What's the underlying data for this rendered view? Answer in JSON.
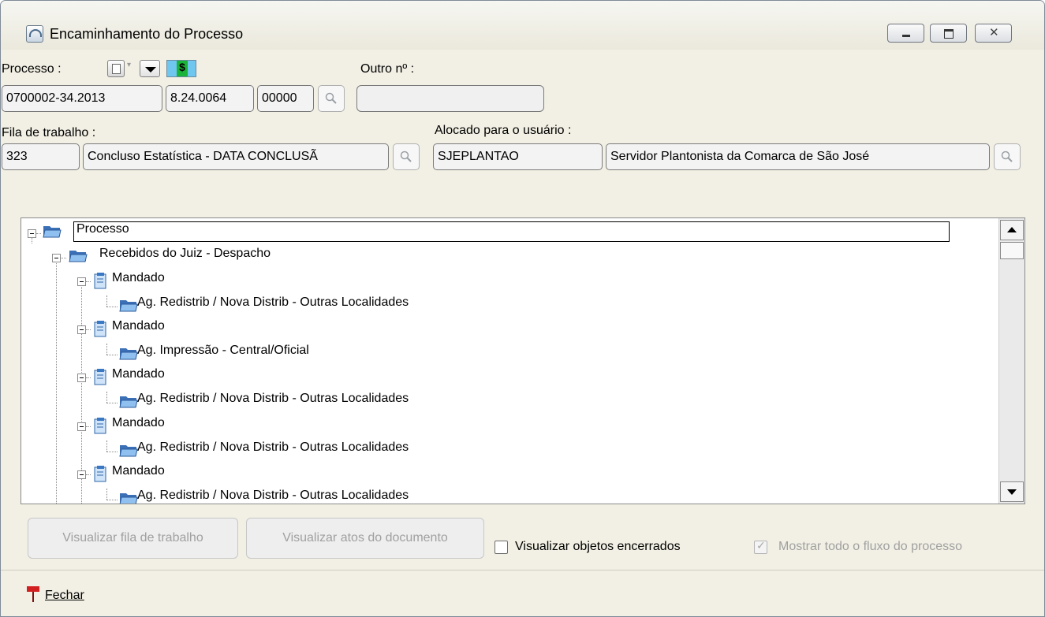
{
  "window": {
    "title": "Encaminhamento do Processo"
  },
  "processo": {
    "label": "Processo :",
    "parts": [
      "0700002-34.2013",
      "8.24.0064",
      "00000"
    ]
  },
  "outro_numero": {
    "label": "Outro nº :",
    "value": ""
  },
  "fila": {
    "label": "Fila de trabalho :",
    "code": "323",
    "name": "Concluso Estatística  - DATA CONCLUSÃ"
  },
  "alocado": {
    "label": "Alocado para o usuário :",
    "login": "SJEPLANTAO",
    "name": "Servidor Plantonista da Comarca de São José"
  },
  "tree": {
    "root": "Processo",
    "child": "Recebidos do Juiz - Despacho",
    "items": [
      {
        "label": "Mandado",
        "sub": "Ag. Redistrib / Nova Distrib - Outras Localidades"
      },
      {
        "label": "Mandado",
        "sub": "Ag. Impressão - Central/Oficial"
      },
      {
        "label": "Mandado",
        "sub": "Ag. Redistrib / Nova Distrib - Outras Localidades"
      },
      {
        "label": "Mandado",
        "sub": "Ag. Redistrib / Nova Distrib - Outras Localidades"
      },
      {
        "label": "Mandado",
        "sub": "Ag. Redistrib / Nova Distrib - Outras Localidades"
      }
    ]
  },
  "buttons": {
    "view_queue": "Visualizar fila de trabalho",
    "view_acts": "Visualizar atos do documento"
  },
  "options": {
    "show_closed": {
      "label": "Visualizar objetos encerrados",
      "checked": false
    },
    "show_flow": {
      "label": "Mostrar todo o fluxo do processo",
      "checked": true
    }
  },
  "footer": {
    "close_label": "Fechar"
  }
}
